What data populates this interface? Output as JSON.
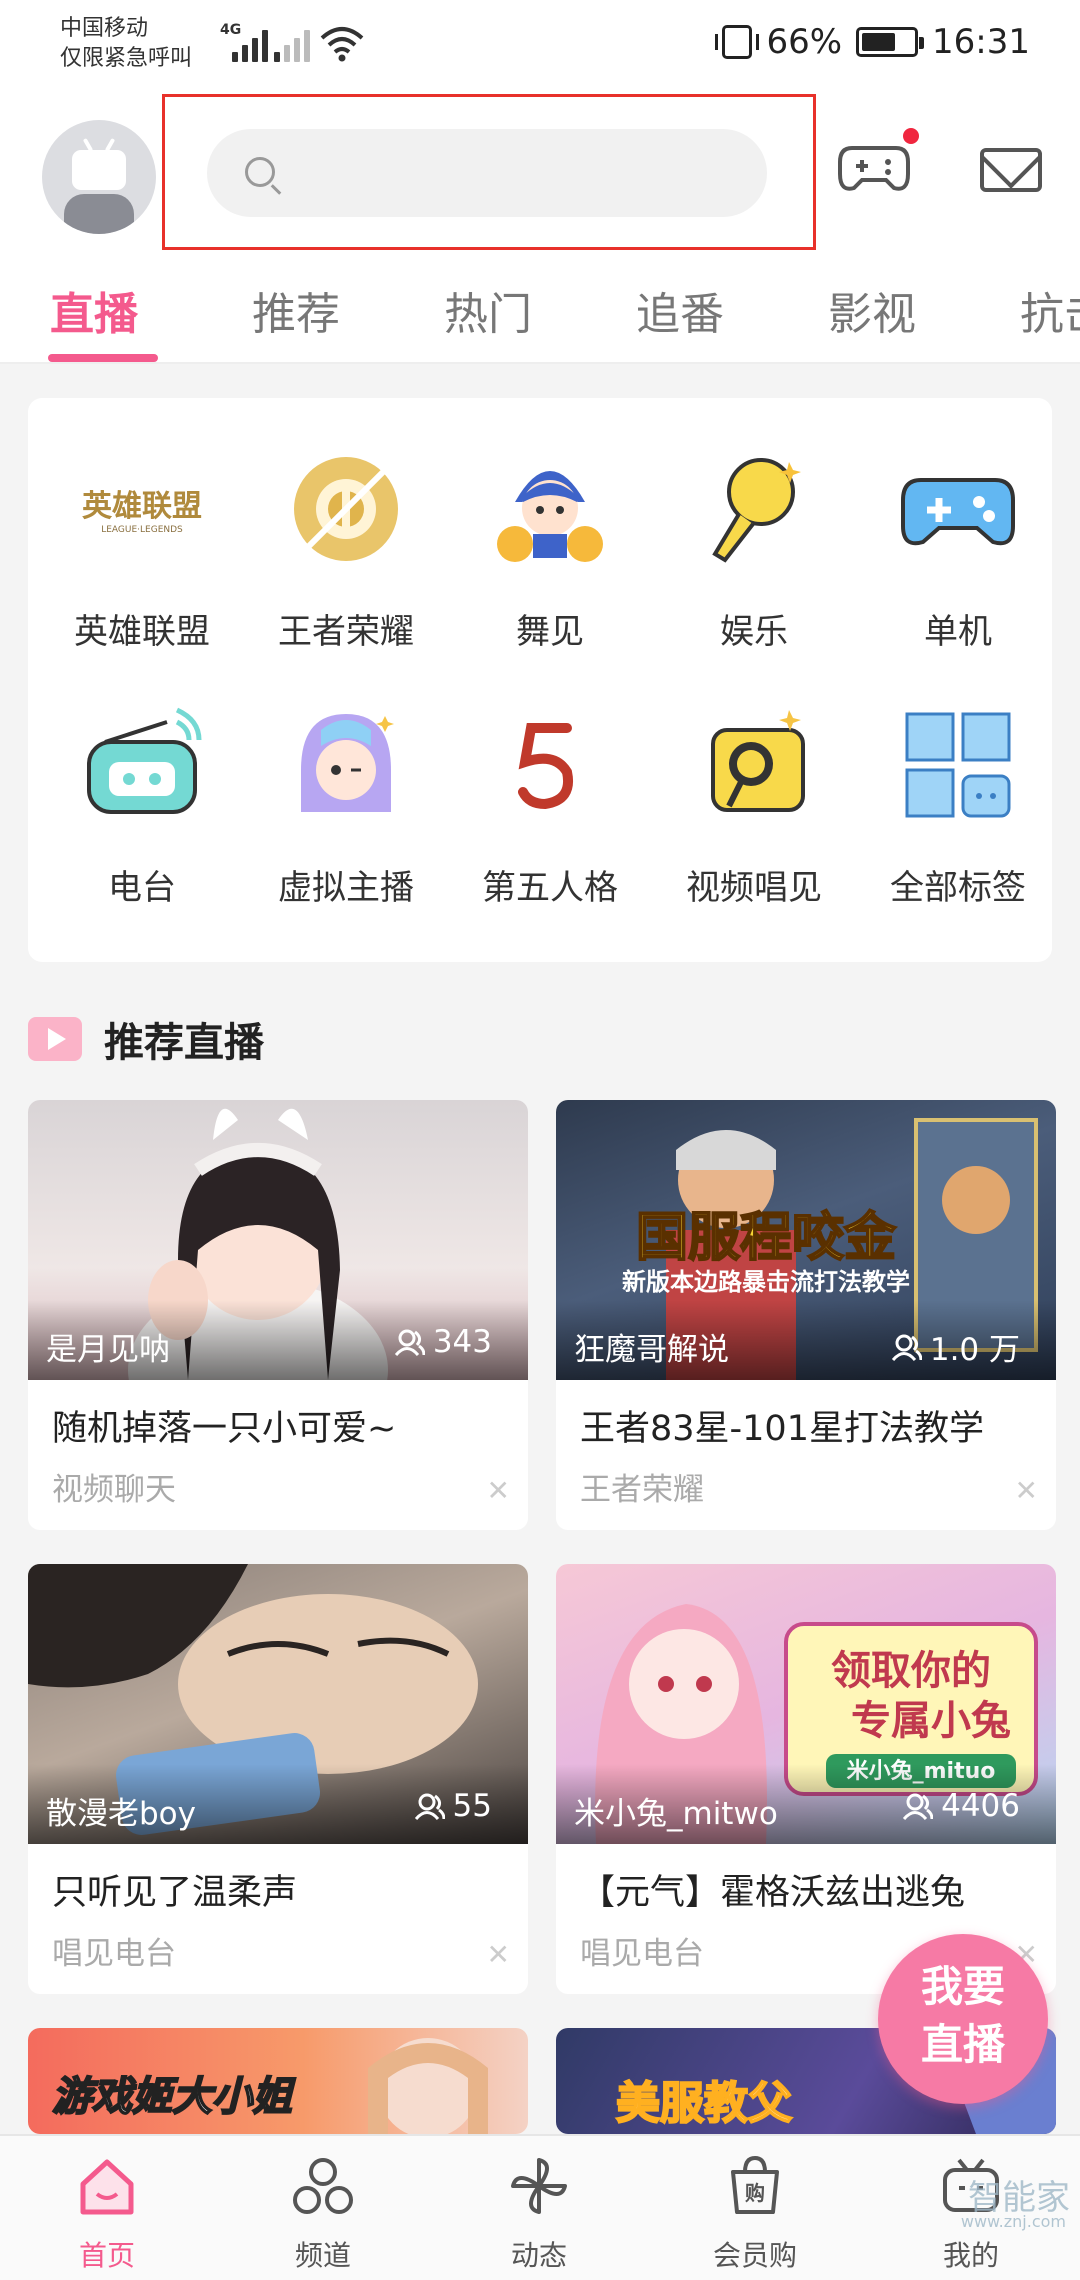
{
  "status_bar": {
    "carrier_line1": "中国移动",
    "carrier_line2": "仅限紧急呼叫",
    "network_tag": "4G",
    "battery": "66%",
    "time": "16:31"
  },
  "header": {
    "search_placeholder": ""
  },
  "tabs": [
    "直播",
    "推荐",
    "热门",
    "追番",
    "影视",
    "抗击"
  ],
  "categories": [
    {
      "label": "英雄联盟",
      "icon": "league-of-legends-icon"
    },
    {
      "label": "王者荣耀",
      "icon": "honor-of-kings-icon"
    },
    {
      "label": "舞见",
      "icon": "dance-icon"
    },
    {
      "label": "娱乐",
      "icon": "microphone-icon"
    },
    {
      "label": "单机",
      "icon": "gamepad-icon"
    },
    {
      "label": "电台",
      "icon": "radio-icon"
    },
    {
      "label": "虚拟主播",
      "icon": "virtual-streamer-icon"
    },
    {
      "label": "第五人格",
      "icon": "identity-v-icon"
    },
    {
      "label": "视频唱见",
      "icon": "video-singing-icon"
    },
    {
      "label": "全部标签",
      "icon": "all-tags-icon"
    }
  ],
  "section": {
    "title": "推荐直播"
  },
  "live_cards": [
    {
      "anchor": "是月见呐",
      "views": "343",
      "title": "随机掉落一只小可爱~",
      "category": "视频聊天"
    },
    {
      "anchor": "狂魔哥解说",
      "views": "1.0 万",
      "title": "王者83星-101星打法教学",
      "category": "王者荣耀",
      "overlay_text": "国服程咬金",
      "overlay_sub": "新版本边路暴击流打法教学"
    },
    {
      "anchor": "散漫老boy",
      "views": "55",
      "title": "只听见了温柔声",
      "category": "唱见电台"
    },
    {
      "anchor": "米小兔_mitwo",
      "views": "4406",
      "title": "【元气】霍格沃兹出逃兔",
      "category": "唱见电台",
      "overlay_text": "领取你的",
      "overlay_text2": "专属小兔",
      "overlay_sub": "米小兔_mituo"
    },
    {
      "overlay_text": "游戏姬大小姐"
    },
    {
      "overlay_text": "美服教父"
    }
  ],
  "fab": {
    "line1": "我要",
    "line2": "直播"
  },
  "bottom_nav": [
    {
      "label": "首页",
      "icon": "home-icon"
    },
    {
      "label": "频道",
      "icon": "channel-icon"
    },
    {
      "label": "动态",
      "icon": "pinwheel-icon"
    },
    {
      "label": "会员购",
      "icon": "shopping-bag-icon"
    },
    {
      "label": "我的",
      "icon": "tv-icon"
    }
  ],
  "watermark": {
    "text": "智能家",
    "sub": "www.znj.com"
  },
  "colors": {
    "accent": "#f45a8d",
    "highlight": "#e8312a"
  }
}
